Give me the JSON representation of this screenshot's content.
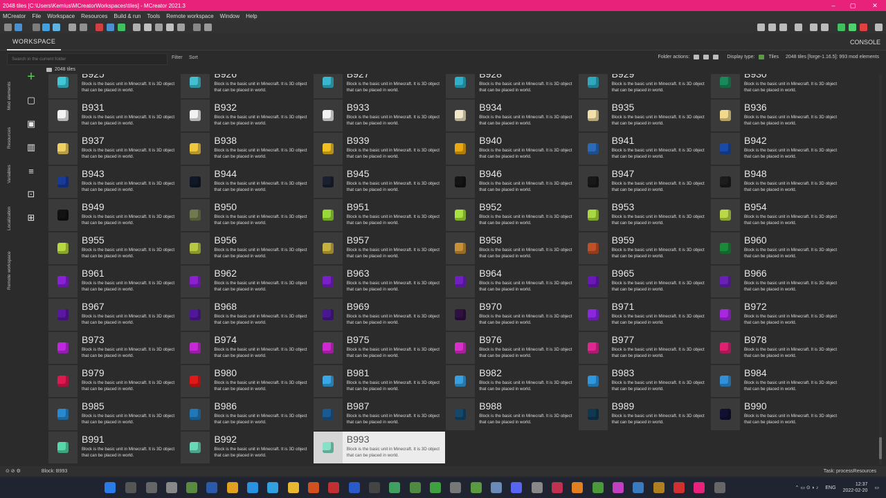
{
  "window": {
    "title": "2048 tiles [C:\\Users\\Kemius\\MCreatorWorkspaces\\tiles] - MCreator 2021.3",
    "controls": [
      "–",
      "▢",
      "✕"
    ]
  },
  "menu": [
    "MCreator",
    "File",
    "Workspace",
    "Resources",
    "Build & run",
    "Tools",
    "Remote workspace",
    "Window",
    "Help"
  ],
  "tabs": {
    "workspace": "WORKSPACE",
    "console": "CONSOLE"
  },
  "filterbar": {
    "search_placeholder": "Search in the current folder",
    "filter": "Filter",
    "sort": "Sort",
    "folder_actions": "Folder actions:",
    "display_type": "Display type:",
    "tiles": "Tiles",
    "workspace_info": "2048 tiles [forge-1.16.5]: 993 mod elements"
  },
  "sidebar_tabs": [
    "Mod elements",
    "Resources",
    "Variables",
    "Localization",
    "Remote workspace"
  ],
  "breadcrumb": "2048 tiles",
  "tile_description": "Block is the basic unit in Minecraft. It is 3D object that can be placed in world.",
  "partial_row": [
    "B925",
    "B926",
    "B927",
    "B928",
    "B929",
    "B930"
  ],
  "tiles": [
    {
      "name": "B931",
      "color": "#f2f2f2"
    },
    {
      "name": "B932",
      "color": "#f2f2f2"
    },
    {
      "name": "B933",
      "color": "#f2f2f2"
    },
    {
      "name": "B934",
      "color": "#f2e6c8"
    },
    {
      "name": "B935",
      "color": "#f2e0a8"
    },
    {
      "name": "B936",
      "color": "#f2d88a"
    },
    {
      "name": "B937",
      "color": "#f0d060"
    },
    {
      "name": "B938",
      "color": "#f0c840"
    },
    {
      "name": "B939",
      "color": "#f0c020"
    },
    {
      "name": "B940",
      "color": "#e8a810"
    },
    {
      "name": "B941",
      "color": "#2a6ab8"
    },
    {
      "name": "B942",
      "color": "#1a4aa8"
    },
    {
      "name": "B943",
      "color": "#1a3a98"
    },
    {
      "name": "B944",
      "color": "#101828"
    },
    {
      "name": "B945",
      "color": "#1a2030"
    },
    {
      "name": "B946",
      "color": "#141414"
    },
    {
      "name": "B947",
      "color": "#181818"
    },
    {
      "name": "B948",
      "color": "#1c1c1c"
    },
    {
      "name": "B949",
      "color": "#121212"
    },
    {
      "name": "B950",
      "color": "#707a50"
    },
    {
      "name": "B951",
      "color": "#98d838"
    },
    {
      "name": "B952",
      "color": "#a8e040"
    },
    {
      "name": "B953",
      "color": "#a8d840"
    },
    {
      "name": "B954",
      "color": "#b8d848"
    },
    {
      "name": "B955",
      "color": "#b8d840"
    },
    {
      "name": "B956",
      "color": "#b8c840"
    },
    {
      "name": "B957",
      "color": "#c8b040"
    },
    {
      "name": "B958",
      "color": "#c89038"
    },
    {
      "name": "B959",
      "color": "#c05028"
    },
    {
      "name": "B960",
      "color": "#1a8a3a"
    },
    {
      "name": "B961",
      "color": "#8a20d8"
    },
    {
      "name": "B962",
      "color": "#8a20d0"
    },
    {
      "name": "B963",
      "color": "#7a20c8"
    },
    {
      "name": "B964",
      "color": "#7020c0"
    },
    {
      "name": "B965",
      "color": "#6a18b8"
    },
    {
      "name": "B966",
      "color": "#6a20b8"
    },
    {
      "name": "B967",
      "color": "#5a18a0"
    },
    {
      "name": "B968",
      "color": "#501898"
    },
    {
      "name": "B969",
      "color": "#481890"
    },
    {
      "name": "B970",
      "color": "#301040"
    },
    {
      "name": "B971",
      "color": "#8a28e0"
    },
    {
      "name": "B972",
      "color": "#a828e0"
    },
    {
      "name": "B973",
      "color": "#c028e0"
    },
    {
      "name": "B974",
      "color": "#c828d8"
    },
    {
      "name": "B975",
      "color": "#d028d0"
    },
    {
      "name": "B976",
      "color": "#d830c8"
    },
    {
      "name": "B977",
      "color": "#e02890"
    },
    {
      "name": "B978",
      "color": "#e02070"
    },
    {
      "name": "B979",
      "color": "#e01850"
    },
    {
      "name": "B980",
      "color": "#e01818"
    },
    {
      "name": "B981",
      "color": "#38a8e8"
    },
    {
      "name": "B982",
      "color": "#38a0e0"
    },
    {
      "name": "B983",
      "color": "#3098e0"
    },
    {
      "name": "B984",
      "color": "#3090d8"
    },
    {
      "name": "B985",
      "color": "#2888d0"
    },
    {
      "name": "B986",
      "color": "#2078b8"
    },
    {
      "name": "B987",
      "color": "#1a5a90"
    },
    {
      "name": "B988",
      "color": "#154868"
    },
    {
      "name": "B989",
      "color": "#103850"
    },
    {
      "name": "B990",
      "color": "#101030"
    },
    {
      "name": "B991",
      "color": "#58d8a8"
    },
    {
      "name": "B992",
      "color": "#68d8b8"
    },
    {
      "name": "B993",
      "color": "#88e0c8",
      "selected": true
    }
  ],
  "status": {
    "left": "Block: B993",
    "right": "Task: processResources"
  },
  "tray": {
    "lang": "ENG",
    "time": "12:37",
    "date": "2022-02-20"
  }
}
